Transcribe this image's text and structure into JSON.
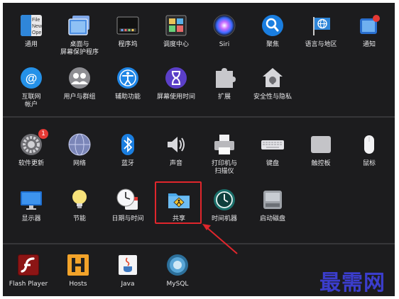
{
  "row1": [
    {
      "label": "通用",
      "icon": "general-icon"
    },
    {
      "label": "桌面与\n屏幕保护程序",
      "icon": "desktop-screensaver-icon"
    },
    {
      "label": "程序坞",
      "icon": "dock-icon"
    },
    {
      "label": "调度中心",
      "icon": "mission-control-icon"
    },
    {
      "label": "Siri",
      "icon": "siri-icon"
    },
    {
      "label": "聚焦",
      "icon": "spotlight-icon"
    },
    {
      "label": "语言与地区",
      "icon": "language-region-icon"
    },
    {
      "label": "通知",
      "icon": "notifications-icon"
    }
  ],
  "row2": [
    {
      "label": "互联网\n帐户",
      "icon": "internet-accounts-icon"
    },
    {
      "label": "用户与群组",
      "icon": "users-groups-icon"
    },
    {
      "label": "辅助功能",
      "icon": "accessibility-icon"
    },
    {
      "label": "屏幕使用时间",
      "icon": "screen-time-icon"
    },
    {
      "label": "扩展",
      "icon": "extensions-icon"
    },
    {
      "label": "安全性与隐私",
      "icon": "security-privacy-icon"
    }
  ],
  "row3": [
    {
      "label": "软件更新",
      "icon": "software-update-icon",
      "badge": "1"
    },
    {
      "label": "网络",
      "icon": "network-icon"
    },
    {
      "label": "蓝牙",
      "icon": "bluetooth-icon"
    },
    {
      "label": "声音",
      "icon": "sound-icon"
    },
    {
      "label": "打印机与\n扫描仪",
      "icon": "printers-scanners-icon"
    },
    {
      "label": "键盘",
      "icon": "keyboard-icon"
    },
    {
      "label": "触控板",
      "icon": "trackpad-icon"
    },
    {
      "label": "鼠标",
      "icon": "mouse-icon"
    }
  ],
  "row4": [
    {
      "label": "显示器",
      "icon": "displays-icon"
    },
    {
      "label": "节能",
      "icon": "energy-saver-icon"
    },
    {
      "label": "日期与时间",
      "icon": "date-time-icon"
    },
    {
      "label": "共享",
      "icon": "sharing-icon"
    },
    {
      "label": "时间机器",
      "icon": "time-machine-icon"
    },
    {
      "label": "启动磁盘",
      "icon": "startup-disk-icon"
    }
  ],
  "row5": [
    {
      "label": "Flash Player",
      "icon": "flash-player-icon"
    },
    {
      "label": "Hosts",
      "icon": "hosts-icon"
    },
    {
      "label": "Java",
      "icon": "java-icon"
    },
    {
      "label": "MySQL",
      "icon": "mysql-icon"
    }
  ],
  "icon_text": {
    "general_lines": [
      "File",
      "New",
      "Ope"
    ]
  },
  "watermark": "最需网",
  "colors": {
    "background": "#1c1c1e",
    "highlight": "#e0262c",
    "watermark": "#3b3dcc"
  }
}
